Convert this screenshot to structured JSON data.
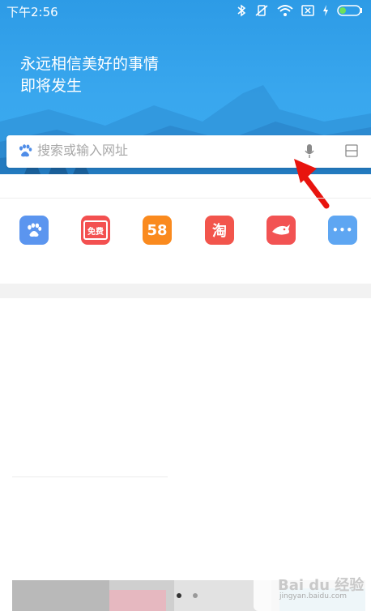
{
  "status_bar": {
    "time": "下午2:56",
    "icons": [
      "bluetooth-icon",
      "vibrate-off-icon",
      "wifi-icon",
      "sim-x-icon",
      "charging-icon",
      "battery-icon"
    ]
  },
  "header": {
    "slogan_line1": "永远相信美好的事情",
    "slogan_line2": "即将发生",
    "bg_color": "#39a7ee"
  },
  "search": {
    "placeholder": "搜索或输入网址",
    "left_icon": "paw-icon",
    "voice_icon": "microphone-icon",
    "scan_icon": "scan-icon"
  },
  "quick_links": [
    {
      "name": "baidu",
      "icon": "paw-icon",
      "text": "",
      "color": "#5b95ef"
    },
    {
      "name": "novel",
      "icon": "book-icon",
      "text": "免费",
      "color": "#f35050"
    },
    {
      "name": "58",
      "icon": "58-icon",
      "text": "58",
      "color": "#fa8a1e"
    },
    {
      "name": "taobao",
      "icon": "taobao-icon",
      "text": "淘",
      "color": "#f2554c"
    },
    {
      "name": "shark",
      "icon": "shark-icon",
      "text": "",
      "color": "#f25353"
    },
    {
      "name": "more",
      "icon": "more-icon",
      "text": "•••",
      "color": "#5ea6f2"
    }
  ],
  "watermark": {
    "main": "Bai du 经验",
    "sub": "jingyan.baidu.com"
  },
  "arrow_color": "#e8140e"
}
